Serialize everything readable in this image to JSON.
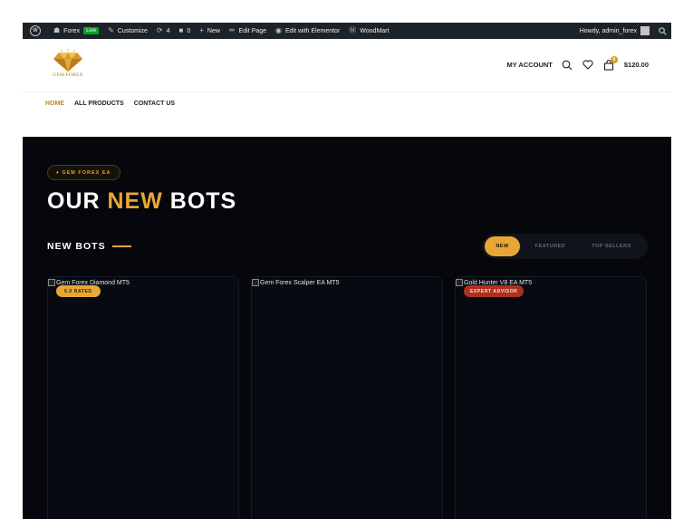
{
  "admin_bar": {
    "site_name": "Forex",
    "live_label": "Live",
    "customize": "Customize",
    "updates_count": "4",
    "comments_count": "0",
    "new": "New",
    "edit_page": "Edit Page",
    "edit_elementor": "Edit with Elementor",
    "woodmart": "WoodMart",
    "greeting": "Howdy, admin_forex"
  },
  "header": {
    "logo_text": "GEM FOREX",
    "my_account": "MY ACCOUNT",
    "cart_count": "0",
    "cart_total": "$120.00"
  },
  "nav": {
    "items": [
      "HOME",
      "ALL PRODUCTS",
      "CONTACT US"
    ]
  },
  "hero": {
    "eyebrow": "♦ GEM FOREX EA",
    "title_part1": "OUR ",
    "title_accent": "NEW",
    "title_part2": " BOTS",
    "section_label": "NEW BOTS"
  },
  "tabs": [
    "NEW",
    "FEATURED",
    "TOP SELLERS"
  ],
  "products": [
    {
      "image_alt": "Gem Forex Diamond MT5",
      "badge": "5.0 RATED",
      "badge_color": "#e8a735"
    },
    {
      "image_alt": "Gem Forex Scalper EA MT5",
      "badge": "",
      "badge_color": ""
    },
    {
      "image_alt": "Gold Hunter V8 EA MT5",
      "badge": "EXPERT ADVISOR",
      "badge_color": "#b0301f"
    }
  ],
  "colors": {
    "accent": "#e8a735",
    "dark_bg": "#06070c",
    "admin_bar": "#1d2327"
  }
}
